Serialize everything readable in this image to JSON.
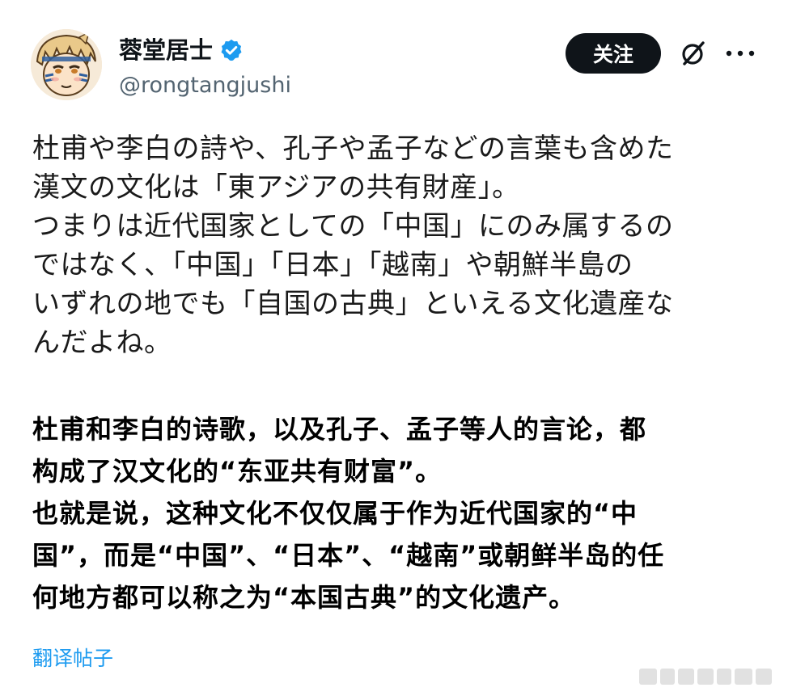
{
  "author": {
    "name": "蓉堂居士",
    "handle": "@rongtangjushi",
    "verified": true,
    "avatar_icon": "anime-character-avatar"
  },
  "actions": {
    "follow_label": "关注",
    "grok_icon": "grok-icon",
    "more_icon": "more-dots-icon"
  },
  "post": {
    "ja_lines": [
      "杜甫や李白の詩や、孔子や孟子などの言葉も含めた",
      "漢文の文化は「東アジアの共有財産」。",
      "つまりは近代国家としての「中国」にのみ属するの",
      "ではなく、「中国」「日本」「越南」や朝鮮半島の",
      "いずれの地でも「自国の古典」といえる文化遺産な",
      "んだよね。"
    ],
    "zh_lines": [
      "杜甫和李白的诗歌，以及孔子、孟子等人的言论，都",
      "构成了汉文化的“东亚共有财富”。",
      "也就是说，这种文化不仅仅属于作为近代国家的“中",
      "国”，而是“中国”、“日本”、“越南”或朝鲜半岛的任",
      "何地方都可以称之为“本国古典”的文化遗产。"
    ],
    "translate_label": "翻译帖子"
  },
  "colors": {
    "accent": "#1d9bf0",
    "follow_bg": "#0f1419",
    "handle": "#536471"
  }
}
